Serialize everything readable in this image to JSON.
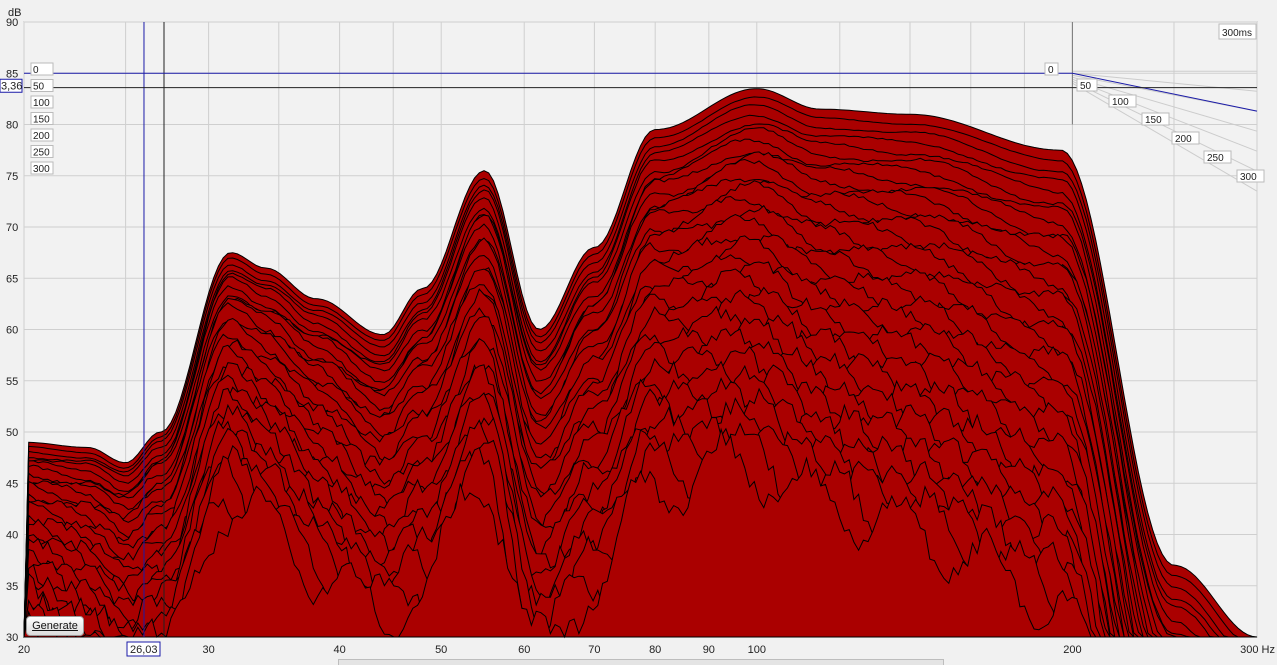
{
  "chart_data": {
    "type": "area",
    "title": "",
    "ylabel": "dB",
    "xlabel": "Hz",
    "x_scale": "log",
    "xlim": [
      20,
      300
    ],
    "ylim": [
      30,
      90
    ],
    "y_ticks": [
      "30",
      "35",
      "40",
      "45",
      "50",
      "55",
      "60",
      "65",
      "70",
      "75",
      "80",
      "85",
      "90"
    ],
    "x_ticks": [
      "20",
      "30",
      "40",
      "50",
      "60",
      "70",
      "80",
      "90",
      "100",
      "200",
      "300 Hz"
    ],
    "time_ticks_left": [
      "0",
      "50",
      "100",
      "150",
      "200",
      "250",
      "300"
    ],
    "time_ticks_right": [
      "0",
      "50",
      "100",
      "150",
      "200",
      "250",
      "300"
    ],
    "time_range_label": "300ms",
    "time_slices_ms": [
      0,
      300
    ],
    "slice_count": 45,
    "cursor": {
      "freq_label": "26,03",
      "level_label": "3,36"
    },
    "front_slice_peaks": [
      {
        "freq": 20,
        "db": 49
      },
      {
        "freq": 23,
        "db": 48.5
      },
      {
        "freq": 25,
        "db": 47
      },
      {
        "freq": 27,
        "db": 50
      },
      {
        "freq": 31.5,
        "db": 67.5
      },
      {
        "freq": 34,
        "db": 66
      },
      {
        "freq": 38,
        "db": 63
      },
      {
        "freq": 44,
        "db": 59.5
      },
      {
        "freq": 48,
        "db": 64
      },
      {
        "freq": 55,
        "db": 75.5
      },
      {
        "freq": 62,
        "db": 60
      },
      {
        "freq": 70,
        "db": 68
      },
      {
        "freq": 80,
        "db": 79.5
      },
      {
        "freq": 100,
        "db": 83.5
      },
      {
        "freq": 115,
        "db": 81.5
      },
      {
        "freq": 140,
        "db": 81
      },
      {
        "freq": 195,
        "db": 77.5
      },
      {
        "freq": 250,
        "db": 37
      },
      {
        "freq": 300,
        "db": 30
      }
    ],
    "colors": {
      "fill": "#aa0000",
      "line": "#000000",
      "grid": "#cccccc",
      "cursor": "#1a1aa8"
    }
  },
  "ui": {
    "generate_label": "Generate"
  }
}
